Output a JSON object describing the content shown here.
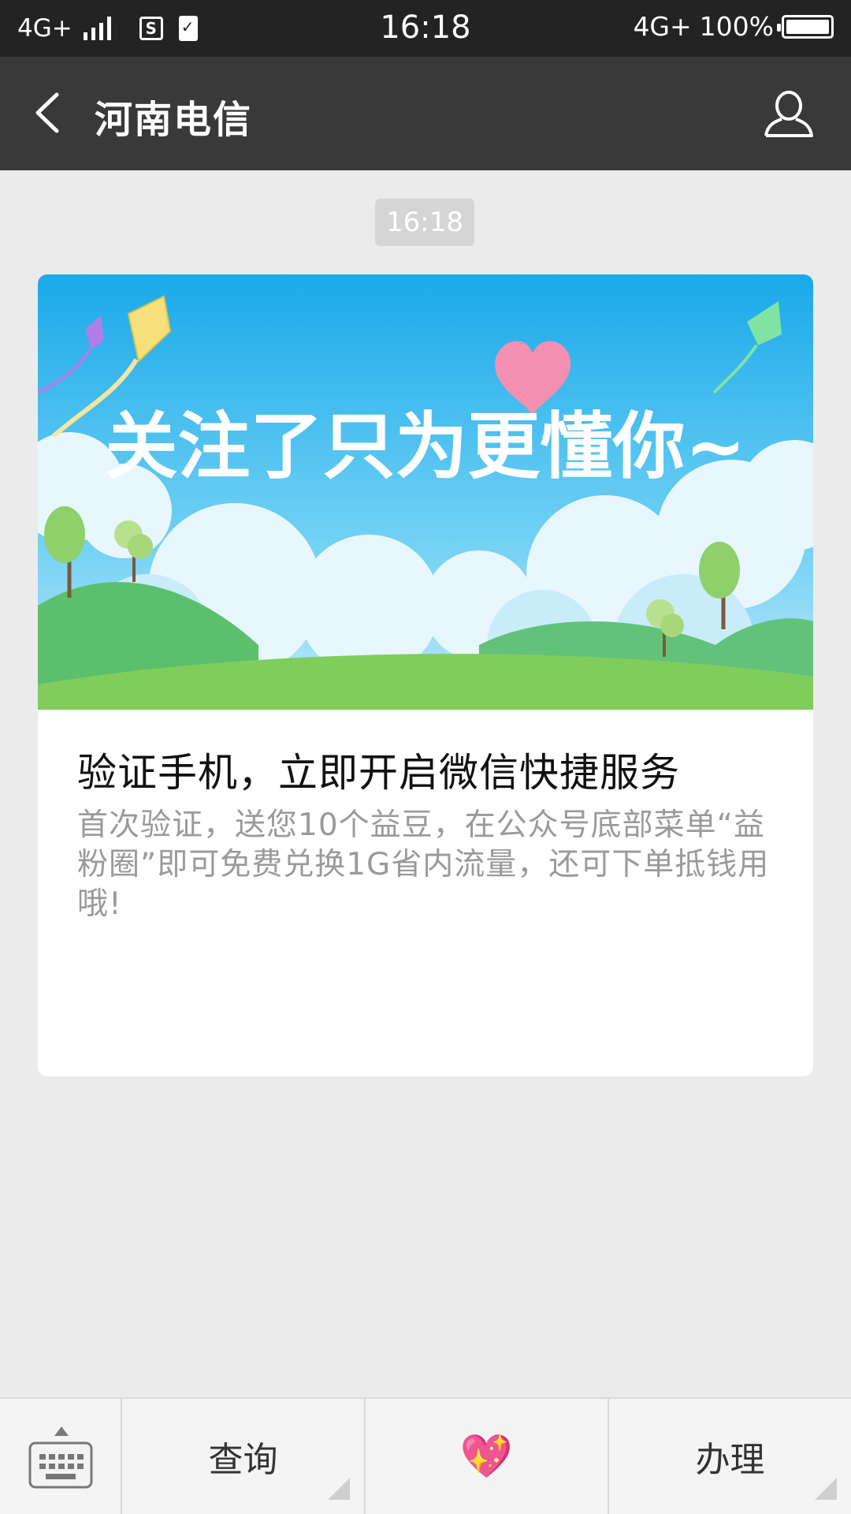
{
  "statusbar": {
    "network_left": "4G+",
    "time": "16:18",
    "network_right": "4G+",
    "battery_percent": "100%",
    "battery_level": 1.0,
    "sim_icon_letter": "S",
    "icons": [
      "signal-icon",
      "sim-icon",
      "clipboard-check-icon",
      "battery-icon"
    ]
  },
  "header": {
    "title": "河南电信",
    "icons": [
      "back-arrow-icon",
      "person-icon"
    ]
  },
  "chat": {
    "timestamp": "16:18",
    "card": {
      "banner_text": "关注了只为更懂你~",
      "title": "验证手机，立即开启微信快捷服务",
      "description": "首次验证，送您10个益豆，在公众号底部菜单“益粉圈”即可免费兑换1G省内流量，还可下单抵钱用哦!"
    }
  },
  "bottom_menu": {
    "items": [
      {
        "label": "查询",
        "has_submenu": true
      },
      {
        "label": "💖",
        "has_submenu": false
      },
      {
        "label": "办理",
        "has_submenu": true
      }
    ],
    "icons": [
      "keyboard-icon",
      "expand-up-icon"
    ]
  },
  "colors": {
    "statusbar": "#232323",
    "topbar": "#393939",
    "background": "#ebebeb",
    "sky": "#29aeea",
    "grass": "#7fcc5c"
  }
}
